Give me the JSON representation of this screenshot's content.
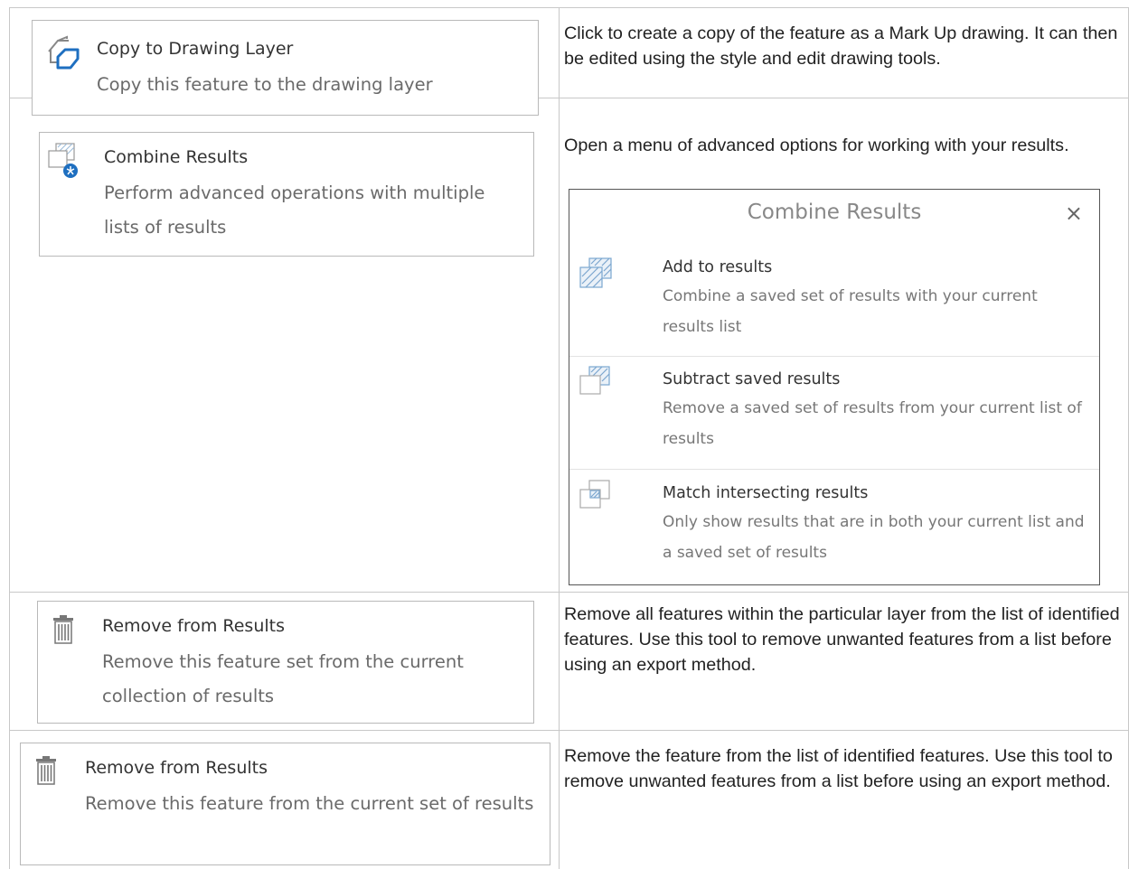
{
  "rows": [
    {
      "tool": {
        "title": "Copy to Drawing Layer",
        "subtitle": "Copy this feature to the drawing layer",
        "icon": "copy-drawing-icon"
      },
      "description": "Click to create a copy of the feature as a Mark Up drawing. It can then be edited using the style and edit drawing tools."
    },
    {
      "tool": {
        "title": "Combine Results",
        "subtitle": "Perform advanced operations with multiple lists of results",
        "icon": "combine-results-icon"
      },
      "description": "Open a menu of advanced options for working with your results.",
      "popup": {
        "title": "Combine Results",
        "close": "×",
        "items": [
          {
            "title": "Add to results",
            "subtitle": "Combine a saved set of results with your current results list",
            "icon": "add-results-icon"
          },
          {
            "title": "Subtract saved results",
            "subtitle": "Remove a saved set of results from your current list of results",
            "icon": "subtract-results-icon"
          },
          {
            "title": "Match intersecting results",
            "subtitle": "Only show results that are in both your current list and a saved set of results",
            "icon": "intersect-results-icon"
          }
        ]
      }
    },
    {
      "tool": {
        "title": "Remove from Results",
        "subtitle": "Remove this feature set from the current collection of results",
        "icon": "trash-icon"
      },
      "description": "Remove all features within the particular layer from the list of identified features. Use this tool to remove unwanted features from a list before using an export method."
    },
    {
      "tool": {
        "title": "Remove from Results",
        "subtitle": "Remove this feature from the current set of results",
        "icon": "trash-icon"
      },
      "description": "Remove the feature from the list of identified features. Use this tool to remove unwanted features from a list before using an export method."
    }
  ],
  "colors": {
    "accent": "#1e6fc0",
    "border": "#c8c8c8",
    "hatch": "#7aa6cf"
  }
}
